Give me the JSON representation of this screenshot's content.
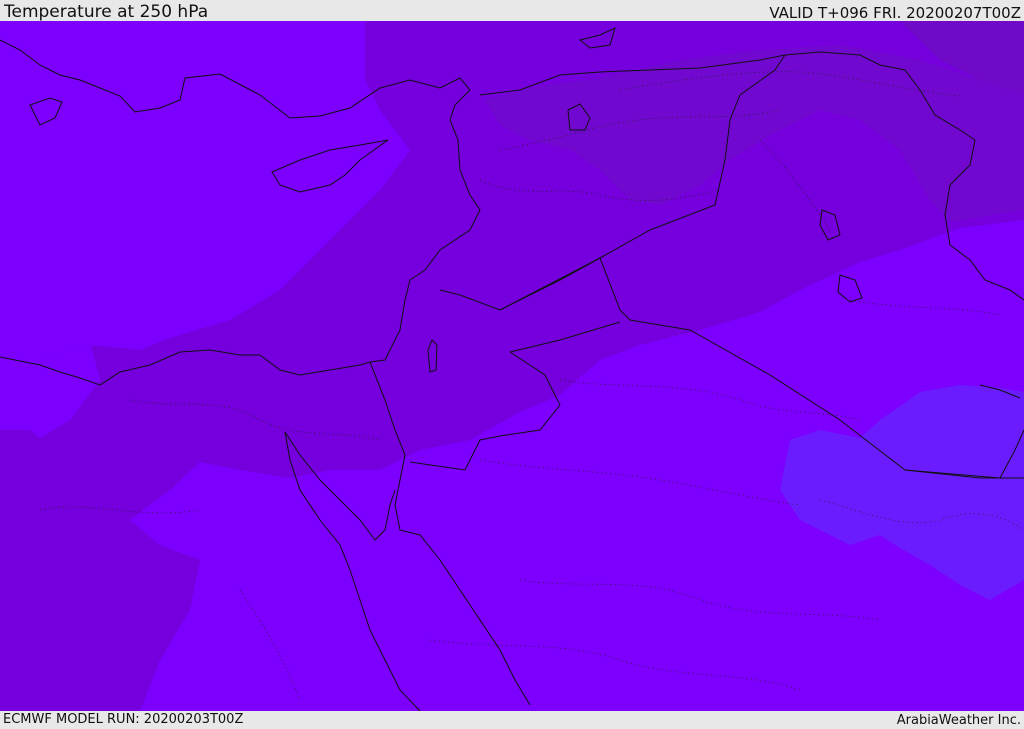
{
  "header": {
    "title": "Temperature at 250 hPa",
    "valid": "VALID T+096 FRI. 20200207T00Z"
  },
  "footer": {
    "model_run": "ECMWF MODEL RUN: 20200203T00Z",
    "credit": "ArabiaWeather Inc."
  },
  "map": {
    "field": "Temperature at 250 hPa",
    "colors": {
      "base": "#7d00ff",
      "darker": "#7500dd",
      "darkest": "#6e0fc4",
      "cooler_patch": "#6b1cff",
      "coast": "#111111"
    }
  }
}
